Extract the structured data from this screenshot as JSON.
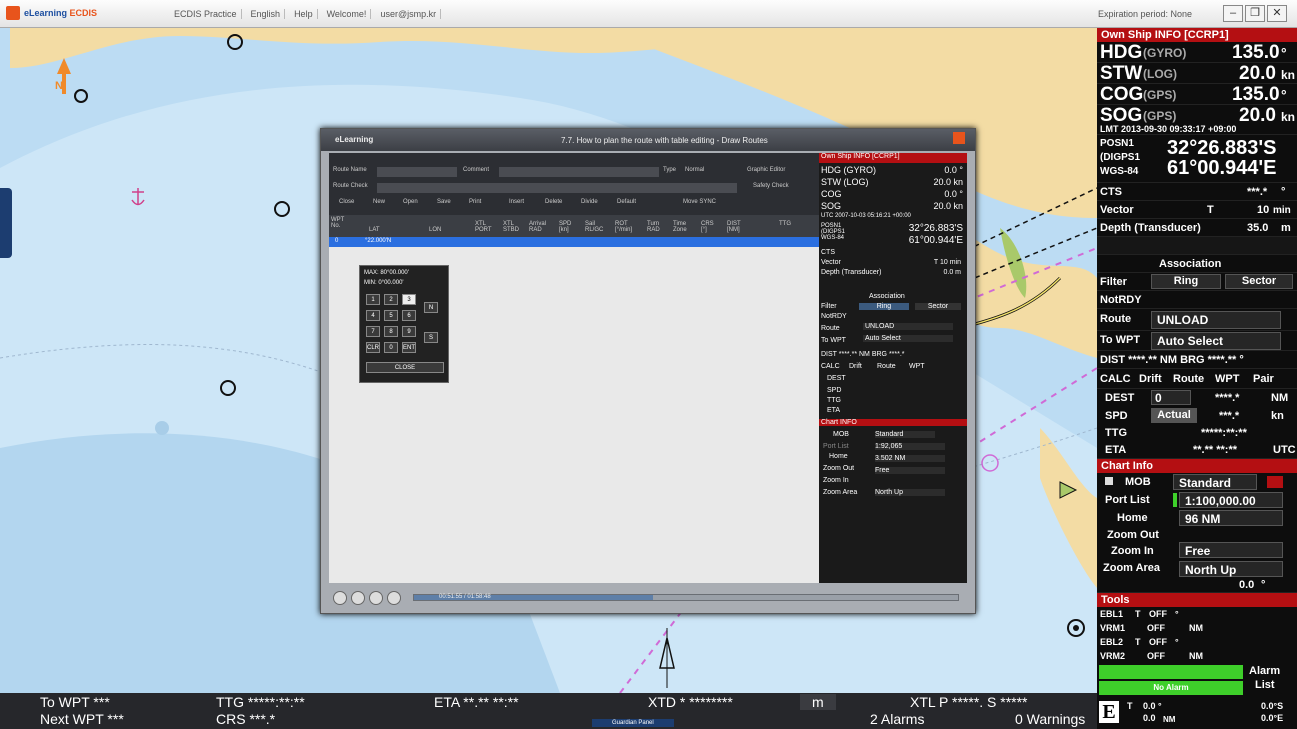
{
  "titlebar": {
    "app_name_a": "eLearning",
    "app_name_b": "ECDIS",
    "menu": [
      "ECDIS Practice",
      "English",
      "Help",
      "Welcome!",
      "user@jsmp.kr"
    ],
    "expiration": "Expiration period: None",
    "minimize": "–",
    "restore": "❐",
    "close": "✕"
  },
  "map": {
    "north_symbol": "N"
  },
  "bottom": {
    "to_wpt": "To WPT ***",
    "next_wpt": "Next WPT ***",
    "ttg": "TTG *****:**:**",
    "crs": "CRS ***.*",
    "eta": "ETA **.** **:**",
    "xtd": "XTD * ********",
    "unit_m": "m",
    "xtl": "XTL P *****. S *****",
    "alarms": "2 Alarms",
    "warnings": "0 Warnings",
    "center_tab": "Guardian Panel"
  },
  "own_ship": {
    "header": "Own Ship INFO [CCRP1]",
    "hdg": {
      "label": "HDG",
      "src": "(GYRO)",
      "value": "135.0",
      "unit": "°"
    },
    "stw": {
      "label": "STW",
      "src": "(LOG)",
      "value": "20.0",
      "unit": "kn"
    },
    "cog": {
      "label": "COG",
      "src": "(GPS)",
      "value": "135.0",
      "unit": "°"
    },
    "sog": {
      "label": "SOG",
      "src": "(GPS)",
      "value": "20.0",
      "unit": "kn"
    },
    "lmt": "LMT 2013-09-30 09:33:17 +09:00",
    "posn": [
      "POSN1",
      "(DIGPS1",
      "WGS-84"
    ],
    "lat": "32°26.883'S",
    "lon": "61°00.944'E",
    "cts_label": "CTS",
    "cts_value": "***.*",
    "cts_unit": "°",
    "vector_label": "Vector",
    "vector_t": "T",
    "vector_value": "10",
    "vector_unit": "min",
    "depth_label": "Depth (Transducer)",
    "depth_value": "35.0",
    "depth_unit": "m"
  },
  "association": {
    "title": "Association",
    "filter": "Filter",
    "ring": "Ring",
    "sector": "Sector",
    "notrdy": "NotRDY"
  },
  "route": {
    "route_label": "Route",
    "route_value": "UNLOAD",
    "towpt_label": "To WPT",
    "towpt_value": "Auto Select",
    "dist_line": "DIST ****.** NM BRG ****.** °",
    "calc": "CALC",
    "drift": "Drift",
    "route_btn": "Route",
    "wpt": "WPT",
    "pair": "Pair",
    "dest_label": "DEST",
    "dest_input": "0",
    "dest_value": "****.*",
    "dest_unit": "NM",
    "spd_label": "SPD",
    "spd_btn": "Actual",
    "spd_value": "***.*",
    "spd_unit": "kn",
    "ttg_label": "TTG",
    "ttg_value": "*****:**:**",
    "eta_label": "ETA",
    "eta_value": "**.** **:**",
    "eta_unit": "UTC"
  },
  "chart_info": {
    "header": "Chart Info",
    "mob": "MOB",
    "standard": "Standard",
    "port_list": "Port List",
    "scale": "1:100,000.00",
    "home": "Home",
    "range": "96 NM",
    "zoom_out": "Zoom Out",
    "zoom_in": "Zoom In",
    "free": "Free",
    "zoom_area": "Zoom Area",
    "north_up": "North Up",
    "angle": "0.0",
    "angle_unit": "°"
  },
  "tools": {
    "header": "Tools",
    "ebl1": "EBL1",
    "ebl1_t": "T",
    "ebl1_state": "OFF",
    "ebl1_unit": "°",
    "vrm1": "VRM1",
    "vrm1_state": "OFF",
    "vrm1_unit": "NM",
    "ebl2": "EBL2",
    "ebl2_t": "T",
    "ebl2_state": "OFF",
    "ebl2_unit": "°",
    "vrm2": "VRM2",
    "vrm2_state": "OFF",
    "vrm2_unit": "NM",
    "alarm": "Alarm",
    "list": "List",
    "no_alarm": "No Alarm",
    "e": "E",
    "t": "T",
    "v1": "0.0 °",
    "v2": "0.0",
    "v2_unit": "NM",
    "r1": "0.0°S",
    "r2": "0.0°E"
  },
  "dialog": {
    "brand": "eLearning",
    "title": "7.7. How to plan the route with table editing - Draw Routes",
    "route_name_label": "Route Name",
    "comment_label": "Comment",
    "type_label": "Type",
    "type_value": "Normal",
    "graphic_editor": "Graphic Editor",
    "route_check": "Route Check",
    "safety_check": "Safety Check",
    "toolbar": [
      "Close",
      "New",
      "Open",
      "Save",
      "Print",
      "Insert",
      "Delete",
      "Divide",
      "Default",
      "Move SYNC"
    ],
    "columns": [
      "WPT No.",
      "LAT",
      "LON",
      "XTL PORT",
      "XTL STBD",
      "Arrival RAD",
      "SPD [kn]",
      "Sail RL/GC",
      "ROT [°/min]",
      "Turn RAD",
      "Time Zone",
      "CRS [°]",
      "DIST [NM]",
      "TTG"
    ],
    "row_no": "0",
    "row_lat": "°22.000'N",
    "row_lon": "",
    "keypad_max": "MAX: 80°00.000'",
    "keypad_min": "MIN: 0°00.000'",
    "keypad_keys": [
      "1",
      "2",
      "3",
      "4",
      "5",
      "6",
      "7",
      "8",
      "9",
      "CLR",
      "0",
      "ENT"
    ],
    "keypad_n": "N",
    "keypad_s": "S",
    "keypad_close": "CLOSE",
    "player_time": "00:51:55 / 01:58:48"
  },
  "mini": {
    "header": "Own Ship INFO [CCRP1]",
    "hdg": "HDG (GYRO)",
    "hdg_v": "0.0 °",
    "stw": "STW (LOG)",
    "stw_v": "20.0 kn",
    "cog": "COG",
    "cog_v": "0.0 °",
    "sog": "SOG",
    "sog_v": "20.0 kn",
    "utc": "UTC 2007-10-03 05:16:21 +00:00",
    "posn": "POSN1 (DIGPS1 WGS-84",
    "lat": "32°26.883'S",
    "lon": "61°00.944'E",
    "cts": "CTS",
    "vector": "Vector",
    "vector_v": "T   10 min",
    "depth": "Depth (Transducer)",
    "depth_v": "0.0 m",
    "association": "Association",
    "filter": "Filter",
    "ring": "Ring",
    "sector": "Sector",
    "notrdy": "NotRDY",
    "route": "Route",
    "route_v": "UNLOAD",
    "towpt": "To WPT",
    "towpt_v": "Auto Select",
    "dist": "DIST ****.** NM BRG ****.*",
    "calc": "CALC",
    "drift": "Drift",
    "route_btn": "Route",
    "wpt": "WPT",
    "dest": "DEST",
    "spd": "SPD",
    "ttg": "TTG",
    "eta": "ETA",
    "chart_info": "Chart INFO",
    "mob": "MOB",
    "standard": "Standard",
    "port_list": "Port List",
    "scale": "1:92,065",
    "home": "Home",
    "range": "3.502 NM",
    "zoom_out": "Zoom Out",
    "zoom_in": "Zoom In",
    "free": "Free",
    "zoom_area": "Zoom Area",
    "north_up": "North Up"
  }
}
